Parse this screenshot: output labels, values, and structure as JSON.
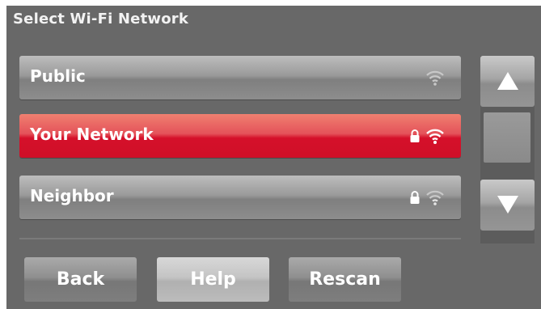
{
  "header": {
    "title": "Select Wi-Fi Network"
  },
  "networks": [
    {
      "name": "Public",
      "secured": false,
      "signal": "weak",
      "selected": false
    },
    {
      "name": "Your Network",
      "secured": true,
      "signal": "strong",
      "selected": true
    },
    {
      "name": "Neighbor",
      "secured": true,
      "signal": "weak",
      "selected": false
    }
  ],
  "buttons": {
    "back": "Back",
    "help": "Help",
    "rescan": "Rescan"
  },
  "scroll": {
    "up_icon": "triangle-up",
    "down_icon": "triangle-down"
  },
  "colors": {
    "background": "#686868",
    "selected": "#d5102a",
    "row": "#9a9a9a",
    "text": "#ffffff"
  }
}
